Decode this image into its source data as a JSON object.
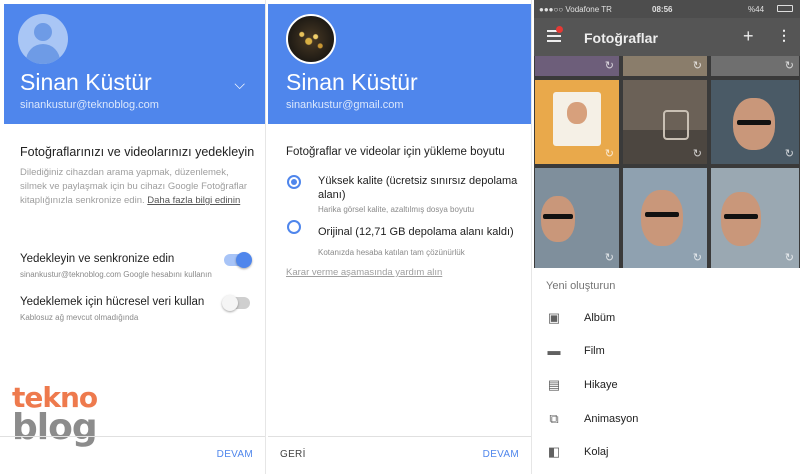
{
  "screen1": {
    "name": "Sinan Küstür",
    "email": "sinankustur@teknoblog.com",
    "chevron": "chevron-down-icon",
    "section_title": "Fotoğraflarınızı ve videolarınızı yedekleyin",
    "description": "Dilediğiniz cihazdan arama yapmak, düzenlemek, silmek ve paylaşmak için bu cihazı Google Fotoğraflar kitaplığınızla senkronize edin.",
    "learn_more": "Daha fazla bilgi edinin",
    "backup_title": "Yedekleyin ve senkronize edin",
    "backup_sub": "sinankustur@teknoblog.com Google hesabını kullanın",
    "backup_on": true,
    "cellular_title": "Yedeklemek için hücresel veri kullan",
    "cellular_sub": "Kablosuz ağ mevcut olmadığında",
    "cellular_on": false,
    "next_button": "DEVAM",
    "logo_top": "tekno",
    "logo_bottom": "blog"
  },
  "screen2": {
    "name": "Sinan Küstür",
    "email": "sinankustur@gmail.com",
    "section_title": "Fotoğraflar ve videolar için yükleme boyutu",
    "options": [
      {
        "title": "Yüksek kalite (ücretsiz sınırsız depolama alanı)",
        "sub": "Harika görsel kalite, azaltılmış dosya boyutu",
        "selected": true
      },
      {
        "title": "Orijinal (12,71 GB depolama alanı kaldı)",
        "sub": "Kotanızda hesaba katılan tam çözünürlük",
        "selected": false
      }
    ],
    "help_link": "Karar verme aşamasında yardım alın",
    "back_button": "GERİ",
    "next_button": "DEVAM"
  },
  "screen3": {
    "status": {
      "carrier": "●●●○○ Vodafone TR",
      "time": "08:56",
      "battery": "%44"
    },
    "title": "Fotoğraflar",
    "sheet_title": "Yeni oluşturun",
    "items": [
      {
        "label": "Albüm",
        "icon": "album-icon"
      },
      {
        "label": "Film",
        "icon": "film-icon"
      },
      {
        "label": "Hikaye",
        "icon": "story-icon"
      },
      {
        "label": "Animasyon",
        "icon": "animation-icon"
      },
      {
        "label": "Kolaj",
        "icon": "collage-icon"
      }
    ]
  },
  "colors": {
    "accent": "#4f86ec",
    "header": "#4f86ec",
    "logo_orange": "#ee7a4d",
    "logo_gray": "#8c8c8c"
  }
}
